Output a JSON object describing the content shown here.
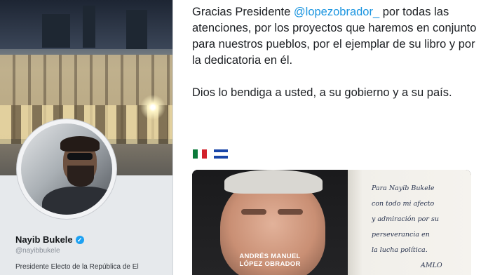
{
  "profile": {
    "name": "Nayib Bukele",
    "handle": "@nayibbukele",
    "bio": "Presidente Electo de la República de El",
    "verified": true
  },
  "tweet": {
    "line1_pre": "Gracias Presidente ",
    "mention": "@lopezobrador_",
    "line1_post": " por todas las atenciones, por los proyectos que haremos en conjunto para nuestros pueblos, por el ejemplar de su libro y por la dedicatoria en él.",
    "paragraph2": "Dios lo bendiga a usted, a su gobierno y a su país.",
    "flags": [
      "mexico-flag",
      "el-salvador-flag"
    ],
    "colors": {
      "mention": "#1b95e0",
      "text": "#1c1f23"
    }
  },
  "media": {
    "book_author_line1": "ANDRÉS MANUEL",
    "book_author_line2": "LÓPEZ OBRADOR",
    "dedication": [
      "Para Nayib Bukele",
      "con todo mi afecto",
      "y admiración por su",
      "perseverancia en",
      "la lucha política.",
      "AMLO"
    ]
  }
}
